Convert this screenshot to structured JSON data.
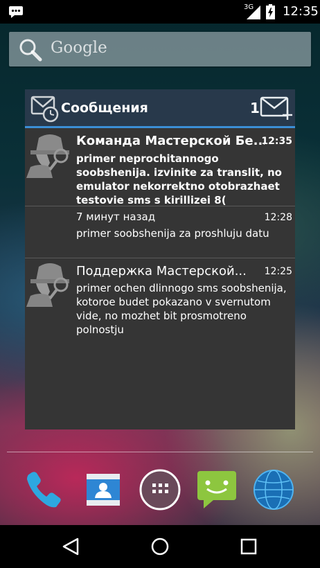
{
  "status_bar": {
    "notification_icon": "messaging-icon",
    "network_type": "3G",
    "signal_icon": "signal-icon",
    "battery_icon": "battery-charging-icon",
    "time": "12:35"
  },
  "search": {
    "icon": "search-icon",
    "label": "Google"
  },
  "widget": {
    "header_icon": "message-clock-icon",
    "title": "Сообщения",
    "unread_count": "1",
    "compose_icon": "compose-message-icon",
    "messages": [
      {
        "avatar_icon": "detective-avatar-icon",
        "sender": "Команда Мастерской Бе...",
        "time": "12:35",
        "body": "primer neprochitannogo soobshenija. izvinite za translit, no emulator nekorrektno otobrazhaet testovie sms s kirillizei 8(",
        "unread": true
      },
      {
        "sender": "7 минут назад",
        "time": "12:28",
        "body": "primer soobshenija za proshluju datu",
        "unread": false
      },
      {
        "avatar_icon": "detective-avatar-icon",
        "sender": "Поддержка Мастерской...",
        "time": "12:25",
        "body": "primer ochen dlinnogo sms soobshenija, kotoroe budet pokazano v svernutom vide, no mozhet bit prosmotreno polnostju",
        "unread": false
      }
    ]
  },
  "dock": {
    "items": [
      "phone-icon",
      "contacts-icon",
      "all-apps-icon",
      "messaging-app-icon",
      "browser-globe-icon"
    ]
  },
  "nav_bar": {
    "items": [
      "back-icon",
      "home-icon",
      "recents-icon"
    ]
  },
  "colors": {
    "widget_bg": "#353535",
    "widget_header": "#28394b",
    "accent_line": "#3b8fd6"
  }
}
